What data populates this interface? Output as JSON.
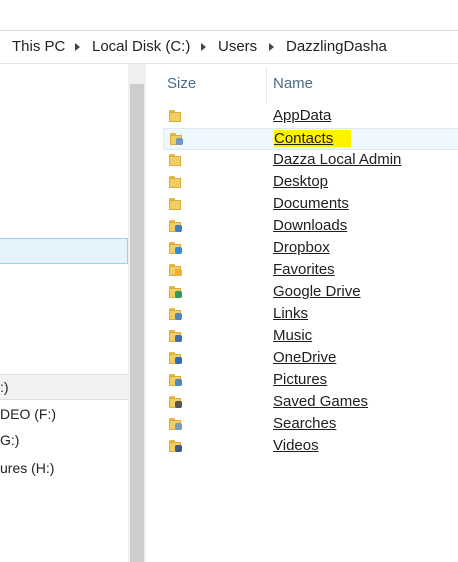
{
  "breadcrumb": {
    "items": [
      "This PC",
      "Local Disk (C:)",
      "Users",
      "DazzlingDasha"
    ]
  },
  "nav": {
    "items": [
      ":)",
      "DEO (F:)",
      "G:)",
      "ures (H:)"
    ]
  },
  "columns": {
    "size": "Size",
    "name": "Name"
  },
  "files": [
    {
      "name": "AppData",
      "icon": "folder-icon"
    },
    {
      "name": "Contacts",
      "icon": "contacts-folder-icon"
    },
    {
      "name": "Dazza Local Admin",
      "icon": "folder-icon"
    },
    {
      "name": "Desktop",
      "icon": "folder-icon"
    },
    {
      "name": "Documents",
      "icon": "folder-icon"
    },
    {
      "name": "Downloads",
      "icon": "downloads-folder-icon"
    },
    {
      "name": "Dropbox",
      "icon": "dropbox-folder-icon"
    },
    {
      "name": "Favorites",
      "icon": "favorites-folder-icon"
    },
    {
      "name": "Google Drive",
      "icon": "google-drive-folder-icon"
    },
    {
      "name": "Links",
      "icon": "links-folder-icon"
    },
    {
      "name": "Music",
      "icon": "music-folder-icon"
    },
    {
      "name": "OneDrive",
      "icon": "onedrive-folder-icon"
    },
    {
      "name": "Pictures",
      "icon": "pictures-folder-icon"
    },
    {
      "name": "Saved Games",
      "icon": "saved-games-folder-icon"
    },
    {
      "name": "Searches",
      "icon": "searches-folder-icon"
    },
    {
      "name": "Videos",
      "icon": "videos-folder-icon"
    }
  ],
  "highlighted_file": "Contacts",
  "colors": {
    "highlight": "#fff200",
    "header_text": "#4b6c8a",
    "folder": "#f2cd62"
  }
}
